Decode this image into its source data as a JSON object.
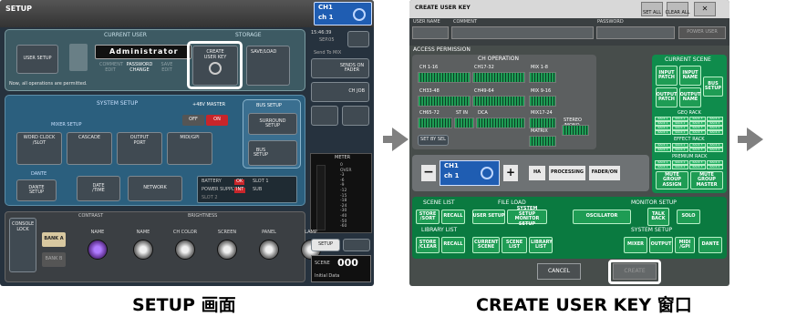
{
  "setup": {
    "title": "SETUP",
    "channel": {
      "name": "CH1",
      "sub": "ch 1"
    },
    "current_user_header": "CURRENT USER",
    "storage_header": "STORAGE",
    "user_setup": "USER SETUP",
    "user_name": "Administrator",
    "comment_edit": "COMMENT EDIT",
    "password_change": "PASSWORD CHANGE",
    "save_edit": "SAVE EDIT",
    "create_user_key": "CREATE USER KEY",
    "save_load": "SAVE/LOAD",
    "status": "Now, all operations are permitted.",
    "time": "15:46:39",
    "date": "SEP.05",
    "send_to": "Send To MIX",
    "sends_on_fader": "SENDS ON FADER",
    "ch_job": "CH JOB",
    "system_setup": "SYSTEM SETUP",
    "master_48v": "+48V MASTER",
    "off": "OFF",
    "on": "ON",
    "bus_setup_header": "BUS SETUP",
    "surround_setup": "SURROUND SETUP",
    "mixer_setup": "MIXER SETUP",
    "word_clock": "WORD CLOCK /SLOT",
    "cascade": "CASCADE",
    "output_port": "OUTPUT PORT",
    "midi_gpi": "MIDI/GPI",
    "bus_setup": "BUS SETUP",
    "dante_header": "DANTE",
    "dante_setup": "DANTE SETUP",
    "date_time": "DATE /TIME",
    "network": "NETWORK",
    "battery": "BATTERY",
    "power_supply": "POWER SUPPLY",
    "ok": "OK",
    "int": "INT",
    "sub_label": "SUB",
    "slot_a": "SLOT 1",
    "slot_b": "SLOT 2",
    "meter": "METER",
    "meter_scale": [
      "0",
      "OVER",
      "-3",
      "-6",
      "-9",
      "-12",
      "-15",
      "-18",
      "-24",
      "-30",
      "-40",
      "-50",
      "-60"
    ],
    "console_lock": "CONSOLE LOCK",
    "bank_a": "BANK A",
    "bank_b": "BANK B",
    "contrast": "CONTRAST",
    "brightness": "BRIGHTNESS",
    "knobs": [
      "NAME",
      "NAME",
      "CH COLOR",
      "SCREEN",
      "PANEL",
      "LAMP"
    ],
    "setup_btn": "SETUP",
    "scene_label": "SCENE",
    "scene_num": "000",
    "scene_name": "Initial Data"
  },
  "ukey": {
    "title": "CREATE USER KEY",
    "set_all": "SET ALL",
    "clear_all": "CLEAR ALL",
    "user_name": "USER NAME",
    "comment": "COMMENT",
    "password": "PASSWORD",
    "power_user": "POWER USER",
    "access_permission": "ACCESS PERMISSION",
    "ch_operation": "CH OPERATION",
    "ch_groups": [
      "CH 1-16",
      "CH17-32",
      "MIX 1-8",
      "CH33-48",
      "CH49-64",
      "MIX 9-16",
      "CH65-72",
      "ST IN",
      "DCA",
      "MIX17-24",
      "MATRIX",
      "STEREO /MONO"
    ],
    "set_by_sel": "SET BY SEL",
    "current_scene": "CURRENT SCENE",
    "input_patch": "INPUT PATCH",
    "input_name": "INPUT NAME",
    "bus_setup": "BUS SETUP",
    "output_patch": "OUTPUT PATCH",
    "output_name": "OUTPUT NAME",
    "geq_rack": "GEQ RACK",
    "effect_rack": "EFFECT RACK",
    "premium_rack": "PREMIUM RACK",
    "rack_cells": [
      "RACK 1",
      "RACK 2",
      "RACK 3",
      "RACK 4"
    ],
    "channel": {
      "name": "CH1",
      "sub": "ch 1"
    },
    "ha": "HA",
    "processing": "PROCESSING",
    "fader_on": "FADER/ON",
    "mute_group_assign": "MUTE GROUP ASSIGN",
    "mute_group_master": "MUTE GROUP MASTER",
    "scene_list": "SCENE LIST",
    "store_sort": "STORE /SORT",
    "recall": "RECALL",
    "file_load": "FILE LOAD",
    "user_setup": "USER SETUP",
    "system_setup_monitor": "SYSTEM SETUP MONITOR SETUP",
    "monitor_setup": "MONITOR SETUP",
    "oscillator": "OSCILLATOR",
    "talkback": "TALK BACK",
    "solo": "SOLO",
    "library_list": "LIBRARY LIST",
    "store_clear": "STORE /CLEAR",
    "recall2": "RECALL",
    "current_scene_btn": "CURRENT SCENE",
    "scene_list_btn": "SCENE LIST",
    "library_list_btn": "LIBRARY LIST",
    "system_setup": "SYSTEM SETUP",
    "mixer": "MIXER",
    "output": "OUTPUT",
    "midi_gpi": "MIDI /GPI",
    "dante": "DANTE",
    "cancel": "CANCEL",
    "create": "CREATE"
  },
  "captions": {
    "left": "SETUP 画面",
    "right": "CREATE USER KEY 窗口"
  }
}
